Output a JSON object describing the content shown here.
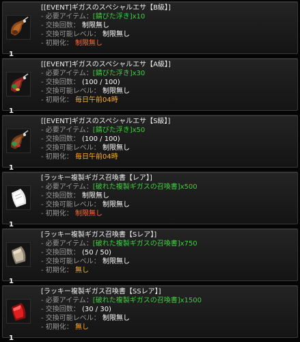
{
  "labels": {
    "required": "- 必要アイテム：",
    "exchanges": "- 交換回数：",
    "level": "- 交換可能レベル：",
    "reset": "- 初期化："
  },
  "items": [
    {
      "title": "[[EVENT]ギガスのスペシャルエサ【B級】]",
      "required_item": "[錆びた浮き]",
      "required_count": "x10",
      "exchanges": "制限無し",
      "level": "制限無し",
      "reset": "制限無し",
      "quantity": "1",
      "icon": "fishing-float-bait-icon"
    },
    {
      "title": "[[EVENT]ギガスのスペシャルエサ【A級】]",
      "required_item": "[錆びた浮き]",
      "required_count": "x30",
      "exchanges": "(100 / 100)",
      "level": "制限無し",
      "reset": "毎日午前04時",
      "quantity": "1",
      "icon": "fishing-float-bait-icon"
    },
    {
      "title": "[[EVENT]ギガスのスペシャルエサ【S級】]",
      "required_item": "[錆びた浮き]",
      "required_count": "x50",
      "exchanges": "(100 / 100)",
      "level": "制限無し",
      "reset": "毎日午前04時",
      "quantity": "1",
      "icon": "fishing-float-bait-icon"
    },
    {
      "title": "[ラッキー複製ギガス召喚書【レア】]",
      "required_item": "[破れた複製ギガスの召喚書]",
      "required_count": "x500",
      "exchanges": "制限無し",
      "level": "制限無し",
      "reset": "制限無し",
      "quantity": "1",
      "icon": "summon-scroll-white-icon"
    },
    {
      "title": "[ラッキー複製ギガス召喚書【Sレア】]",
      "required_item": "[破れた複製ギガスの召喚書]",
      "required_count": "x750",
      "exchanges": "(50 / 50)",
      "level": "制限無し",
      "reset": "無し",
      "quantity": "1",
      "icon": "summon-scroll-beige-icon"
    },
    {
      "title": "[ラッキー複製ギガス召喚書【SSレア】]",
      "required_item": "[破れた複製ギガスの召喚書]",
      "required_count": "x1500",
      "exchanges": "(30 / 30)",
      "level": "制限無し",
      "reset": "無し",
      "quantity": "1",
      "icon": "summon-scroll-red-icon"
    }
  ]
}
